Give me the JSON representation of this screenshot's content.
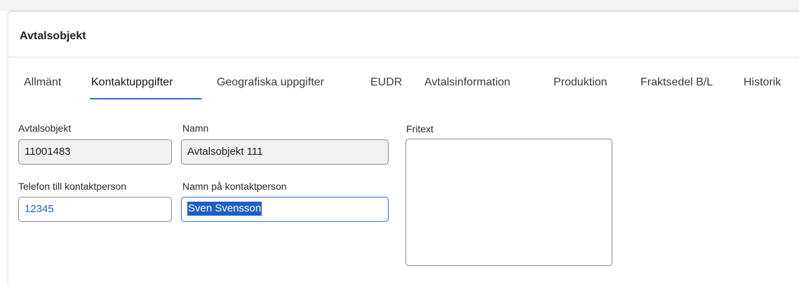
{
  "panel": {
    "title": "Avtalsobjekt"
  },
  "tabs": [
    {
      "label": "Allmänt",
      "active": false
    },
    {
      "label": "Kontaktuppgifter",
      "active": true
    },
    {
      "label": "Geografiska uppgifter",
      "active": false
    },
    {
      "label": "EUDR",
      "active": false
    },
    {
      "label": "Avtalsinformation",
      "active": false
    },
    {
      "label": "Produktion",
      "active": false
    },
    {
      "label": "Fraktsedel B/L",
      "active": false
    },
    {
      "label": "Historik",
      "active": false
    }
  ],
  "form": {
    "avtalsobjekt": {
      "label": "Avtalsobjekt",
      "value": "11001483"
    },
    "namn": {
      "label": "Namn",
      "value": "Avtalsobjekt 111"
    },
    "telefon": {
      "label": "Telefon till kontaktperson",
      "value": "12345"
    },
    "kontaktperson": {
      "label": "Namn på kontaktperson",
      "value": "Sven Svensson"
    },
    "fritext": {
      "label": "Fritext",
      "value": ""
    }
  },
  "colors": {
    "accent": "#2b6fd6",
    "selection": "#1e5fc7",
    "link_text": "#2a63c7",
    "readonly_bg": "#f1f1f1"
  }
}
